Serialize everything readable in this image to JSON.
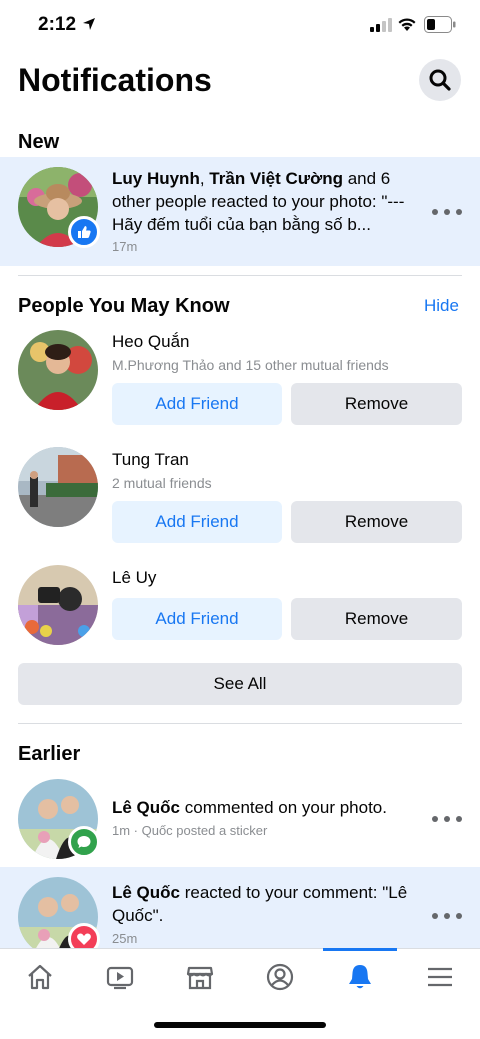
{
  "status_bar": {
    "time": "2:12",
    "icons": [
      "location-arrow-icon",
      "signal-icon",
      "wifi-icon",
      "battery-icon"
    ]
  },
  "header": {
    "title": "Notifications",
    "search_icon": "search-icon"
  },
  "sections": {
    "new": "New",
    "pymk": "People You May Know",
    "earlier": "Earlier"
  },
  "new_notification": {
    "actor1": "Luy Huynh",
    "sep": ", ",
    "actor2": "Trần Việt Cường",
    "text": " and 6 other people reacted to your photo: \"--- Hãy đếm tuổi của bạn bằng số b...",
    "time": "17m",
    "badge": "like-icon"
  },
  "pymk": {
    "hide": "Hide",
    "people": [
      {
        "name": "Heo Quắn",
        "subtitle": "M.Phương Thảo and 15 other mutual friends",
        "add": "Add Friend",
        "remove": "Remove"
      },
      {
        "name": "Tung Tran",
        "subtitle": "2 mutual friends",
        "add": "Add Friend",
        "remove": "Remove"
      },
      {
        "name": "Lê Uy",
        "subtitle": "",
        "add": "Add Friend",
        "remove": "Remove"
      }
    ],
    "see_all": "See All"
  },
  "earlier": [
    {
      "actor": "Lê Quốc",
      "text": " commented on your photo.",
      "meta": "1m · Quốc posted a sticker",
      "badge": "comment-icon"
    },
    {
      "actor": "Lê Quốc",
      "text": " reacted to your comment: \"Lê Quốc\".",
      "meta": "25m",
      "badge": "heart-icon"
    }
  ],
  "tabbar": {
    "tabs": [
      "home-icon",
      "watch-icon",
      "marketplace-icon",
      "profile-icon",
      "notifications-bell-icon",
      "menu-icon"
    ],
    "active": "notifications-bell-icon"
  },
  "colors": {
    "accent": "#1877f2",
    "unread_bg": "#e7f0fd",
    "comment_badge": "#31a24c",
    "heart_badge": "#f33e58"
  }
}
